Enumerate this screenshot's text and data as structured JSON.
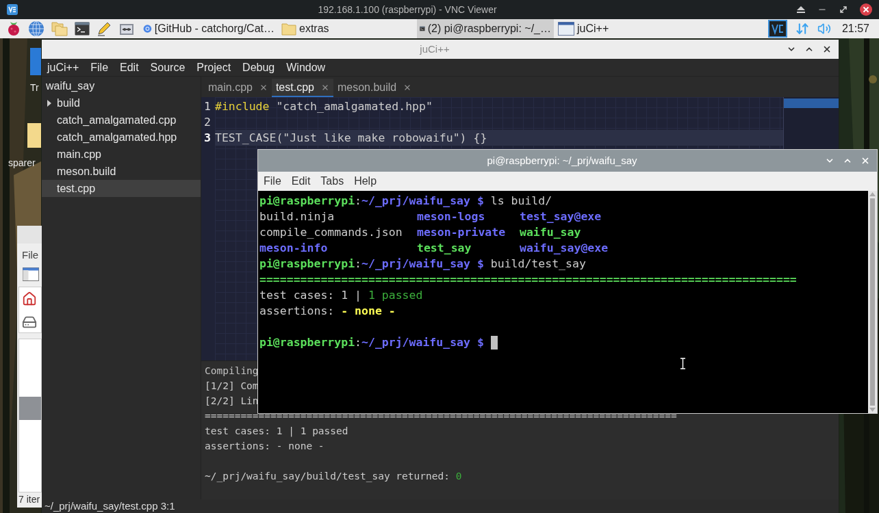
{
  "vnc_viewer": {
    "title": "192.168.1.100 (raspberrypi) - VNC Viewer"
  },
  "taskbar": {
    "tasks": [
      {
        "label": "[GitHub - catchorg/Cat…",
        "kind": "browser",
        "selected": false
      },
      {
        "label": "extras",
        "kind": "folder",
        "selected": false
      },
      {
        "label": "(2) pi@raspberrypi: ~/_…",
        "kind": "terminal",
        "selected": true
      },
      {
        "label": "juCi++",
        "kind": "window",
        "selected": false
      }
    ],
    "clock": "21:57"
  },
  "desktop": {
    "icons": [
      {
        "label": "Tr",
        "kind": "trash"
      },
      {
        "label": "sparer",
        "kind": "folder"
      }
    ]
  },
  "file_manager": {
    "menu": "File",
    "status": "7 iter"
  },
  "juci": {
    "title": "juCi++",
    "menu": [
      "juCi++",
      "File",
      "Edit",
      "Source",
      "Project",
      "Debug",
      "Window"
    ],
    "tree": {
      "label": "waifu_say",
      "children": [
        {
          "label": "build",
          "kind": "folder",
          "expanded": false,
          "selected": false
        },
        {
          "label": "catch_amalgamated.cpp",
          "kind": "file",
          "selected": false
        },
        {
          "label": "catch_amalgamated.hpp",
          "kind": "file",
          "selected": false
        },
        {
          "label": "main.cpp",
          "kind": "file",
          "selected": false
        },
        {
          "label": "meson.build",
          "kind": "file",
          "selected": false
        },
        {
          "label": "test.cpp",
          "kind": "file",
          "selected": true
        }
      ]
    },
    "tabs": [
      {
        "label": "main.cpp",
        "selected": false
      },
      {
        "label": "test.cpp",
        "selected": true
      },
      {
        "label": "meson.build",
        "selected": false
      }
    ],
    "editor": {
      "lines": [
        {
          "number": "1",
          "current": false,
          "segments": [
            {
              "text": "#include",
              "kind": "preprocessor"
            },
            {
              "text": " \"catch_amalgamated.hpp\"",
              "kind": "plain"
            }
          ]
        },
        {
          "number": "2",
          "current": false
        },
        {
          "number": "3",
          "current": true,
          "segments": [
            {
              "text": "TEST_CASE(\"Just like make robowaifu\") {}",
              "kind": "plain"
            }
          ]
        }
      ]
    },
    "output": {
      "lines": [
        {
          "kind": "text",
          "segments": [
            {
              "text": "Compiling",
              "kind": "dim"
            }
          ]
        },
        {
          "kind": "text",
          "segments": [
            {
              "text": "[1/2] Com",
              "kind": "plain"
            }
          ]
        },
        {
          "kind": "text",
          "segments": [
            {
              "text": "[2/2] Lin",
              "kind": "plain"
            }
          ]
        },
        {
          "kind": "text",
          "segments": [
            {
              "text": "===============================================================================",
              "kind": "plain"
            }
          ]
        },
        {
          "kind": "text",
          "segments": [
            {
              "text": "test cases: 1 | 1 passed",
              "kind": "plain"
            }
          ]
        },
        {
          "kind": "text",
          "segments": [
            {
              "text": "assertions: - none -",
              "kind": "plain"
            }
          ]
        },
        {
          "kind": "blank"
        },
        {
          "kind": "text",
          "segments": [
            {
              "text": "~/_prj/waifu_say/build/test_say returned: ",
              "kind": "plain"
            },
            {
              "text": "0",
              "kind": "success"
            }
          ]
        }
      ]
    },
    "status": "~/_prj/waifu_say/test.cpp 3:1"
  },
  "terminal": {
    "title": "pi@raspberrypi: ~/_prj/waifu_say",
    "menu": [
      "File",
      "Edit",
      "Tabs",
      "Help"
    ],
    "lines": [
      {
        "kind": "text",
        "cursor": false,
        "segments": [
          {
            "text": "pi@raspberrypi",
            "kind": "user"
          },
          {
            "text": ":",
            "kind": "plain"
          },
          {
            "text": "~/_prj/waifu_say $",
            "kind": "path"
          },
          {
            "text": " ls build/",
            "kind": "plain"
          }
        ]
      },
      {
        "kind": "columns",
        "cells": [
          {
            "text": "build.ninja",
            "kind": "plain"
          },
          {
            "text": "meson-logs",
            "kind": "dir"
          },
          {
            "text": "test_say@exe",
            "kind": "dir"
          }
        ]
      },
      {
        "kind": "columns",
        "cells": [
          {
            "text": "compile_commands.json",
            "kind": "plain"
          },
          {
            "text": "meson-private",
            "kind": "dir"
          },
          {
            "text": "waifu_say",
            "kind": "exec"
          }
        ]
      },
      {
        "kind": "columns",
        "cells": [
          {
            "text": "meson-info",
            "kind": "dir"
          },
          {
            "text": "test_say",
            "kind": "exec"
          },
          {
            "text": "waifu_say@exe",
            "kind": "dir"
          }
        ]
      },
      {
        "kind": "text",
        "cursor": false,
        "segments": [
          {
            "text": "pi@raspberrypi",
            "kind": "user"
          },
          {
            "text": ":",
            "kind": "plain"
          },
          {
            "text": "~/_prj/waifu_say $",
            "kind": "path"
          },
          {
            "text": " build/test_say",
            "kind": "plain"
          }
        ]
      },
      {
        "kind": "text",
        "cursor": false,
        "segments": [
          {
            "text": "===============================================================================",
            "kind": "rule"
          }
        ]
      },
      {
        "kind": "text",
        "cursor": false,
        "segments": [
          {
            "text": "test cases: 1 | ",
            "kind": "plain"
          },
          {
            "text": "1 passed",
            "kind": "success"
          }
        ]
      },
      {
        "kind": "text",
        "cursor": false,
        "segments": [
          {
            "text": "assertions: ",
            "kind": "plain"
          },
          {
            "text": "- none -",
            "kind": "highlight"
          }
        ]
      },
      {
        "kind": "blank"
      },
      {
        "kind": "text",
        "cursor": true,
        "segments": [
          {
            "text": "pi@raspberrypi",
            "kind": "user"
          },
          {
            "text": ":",
            "kind": "plain"
          },
          {
            "text": "~/_prj/waifu_say $ ",
            "kind": "path"
          }
        ]
      }
    ]
  }
}
